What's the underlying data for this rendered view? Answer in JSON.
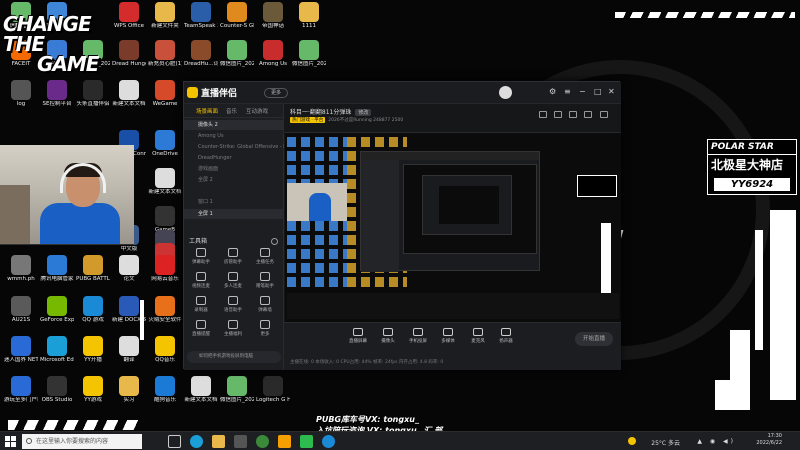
{
  "desktop": {
    "icons": [
      {
        "label": "Brig",
        "color": "#2b5d9c"
      },
      {
        "label": "快捷方式",
        "color": "#3d86d8"
      },
      {
        "label": "WPS Office",
        "color": "#d42c2c"
      },
      {
        "label": "新建文件夹",
        "color": "#e8b94a"
      },
      {
        "label": "TeamSpeak 3",
        "color": "#2a5ea8"
      },
      {
        "label": "Counter-S Global Off...",
        "color": "#e08a1e"
      },
      {
        "label": "帝国神话",
        "color": "#6a5a3a"
      },
      {
        "label": "1111",
        "color": "#e8b94a"
      },
      {
        "label": "FACEIT",
        "color": "#f56a00"
      },
      {
        "label": "平台",
        "color": "#3a7bd5"
      },
      {
        "label": "微信图片_2021080...",
        "color": "#67b96a"
      },
      {
        "label": "Dread Hunger",
        "color": "#7a3b2b"
      },
      {
        "label": "新充员心脏(1)",
        "color": "#c9503a"
      },
      {
        "label": "DreadHu...词罐的下",
        "color": "#8a4b2a"
      },
      {
        "label": "微信图片_2022051...",
        "color": "#67b96a"
      },
      {
        "label": "Among Us",
        "color": "#c92c2c"
      },
      {
        "label": "微信图片_2022062...",
        "color": "#67b96a"
      },
      {
        "label": "log",
        "color": "#555"
      },
      {
        "label": "SE控制平台",
        "color": "#6a2a8a"
      },
      {
        "label": "头条直播伴侣",
        "color": "#2a2a2a"
      },
      {
        "label": "新建文本文档",
        "color": "#ddd"
      },
      {
        "label": "WeGame",
        "color": "#d64a2a"
      },
      {
        "label": "Ubisoft Connect",
        "color": "#1a4fa8"
      },
      {
        "label": "OneDrive",
        "color": "#2d7ad6"
      },
      {
        "label": "腾讯会议",
        "color": "#2a6ad6"
      },
      {
        "label": "新建文本文档",
        "color": "#ddd"
      },
      {
        "label": "Rem",
        "color": "#3a3a3a"
      },
      {
        "label": "GameB",
        "color": "#333"
      },
      {
        "label": "TREL",
        "color": "#445"
      },
      {
        "label": "中文版",
        "color": "#3a5a8a"
      },
      {
        "label": "Feig",
        "color": "#c33"
      },
      {
        "label": "wmmh.ph",
        "color": "#777"
      },
      {
        "label": "腾讯电脑管家",
        "color": "#2a7ad6"
      },
      {
        "label": "PUBG BATTLEGR...",
        "color": "#d29a2a"
      },
      {
        "label": "论文",
        "color": "#ddd"
      },
      {
        "label": "网易云音乐",
        "color": "#d22"
      },
      {
        "label": "腾讯网",
        "color": "#2a7ad6"
      },
      {
        "label": "AU21S",
        "color": "#5a5a5a"
      },
      {
        "label": "GeForce Experience",
        "color": "#76b900"
      },
      {
        "label": "QQ 游戏",
        "color": "#1a8ad6"
      },
      {
        "label": "新建 DOCX 文档",
        "color": "#2a5ab8"
      },
      {
        "label": "火绒安全软件",
        "color": "#e8701a"
      },
      {
        "label": "SYNC 开机启动",
        "color": "#333"
      },
      {
        "label": "迷人国界 NETSHOW...",
        "color": "#2a6ad6"
      },
      {
        "label": "Microsoft Edge",
        "color": "#1aa0d6"
      },
      {
        "label": "YY开播",
        "color": "#f5c400"
      },
      {
        "label": "翻译",
        "color": "#ddd"
      },
      {
        "label": "QQ音乐",
        "color": "#f5c400"
      },
      {
        "label": "新建图片 -20(... 元...",
        "color": "#67b96a"
      },
      {
        "label": "游玩至多门户教程",
        "color": "#2a6ad6"
      },
      {
        "label": "OBS Studio",
        "color": "#333"
      },
      {
        "label": "YY游戏",
        "color": "#f5c400"
      },
      {
        "label": "实习",
        "color": "#e8b94a"
      },
      {
        "label": "酷狗音乐",
        "color": "#1a7ad6"
      },
      {
        "label": "新建文本文档",
        "color": "#ddd"
      },
      {
        "label": "微信图片_2022052...",
        "color": "#67b96a"
      },
      {
        "label": "Logitech G HUB",
        "color": "#2a2a2a"
      },
      {
        "label": "微信图片_2022061...",
        "color": "#67b96a"
      }
    ]
  },
  "logo": {
    "line1": "CHANGE",
    "line2": "THE",
    "line3": "GAME"
  },
  "polar_star": {
    "title": "POLAR STAR",
    "name": "北极星大神店",
    "code": "YY6924"
  },
  "app": {
    "title": "直播伴侣",
    "shortcut": "更多",
    "tabs": [
      "场景画面",
      "音乐",
      "互动游戏"
    ],
    "sources": [
      {
        "label": "摄像头 2",
        "selected": true
      },
      {
        "label": "Among Us",
        "selected": false
      },
      {
        "label": "Counter-Strike: Global Offensive - Direct3D 9",
        "selected": false
      },
      {
        "label": "DreadHunger",
        "selected": false
      },
      {
        "label": "游戏画面",
        "selected": false
      },
      {
        "label": "全屏 2",
        "selected": false
      },
      {
        "label": "窗口 1",
        "selected": false
      },
      {
        "label": "全屏 1",
        "selected": true
      }
    ],
    "tools_header": "工具箱",
    "tools": [
      {
        "label": "弹幕助手"
      },
      {
        "label": "房管助手"
      },
      {
        "label": "主播任务"
      },
      {
        "label": "视频连麦"
      },
      {
        "label": "多人连麦"
      },
      {
        "label": "赠笔助手"
      },
      {
        "label": "录制器"
      },
      {
        "label": "语音助手"
      },
      {
        "label": "弹幕墙"
      },
      {
        "label": "直播提醒"
      },
      {
        "label": "主播福利"
      },
      {
        "label": "更多"
      }
    ],
    "side_hint": "如何把手机游戏投屏到电脑",
    "room_title": "科目一·翻翻811分弹珠",
    "room_edit": "修改",
    "room_meta_tag": "热门游戏 · 平台",
    "room_meta": "2026不过是Running  248877  2500",
    "bottom_buttons": [
      {
        "label": "直播屏幕"
      },
      {
        "label": "摄像头"
      },
      {
        "label": "手机投屏"
      },
      {
        "label": "多媒体"
      },
      {
        "label": "麦克风"
      },
      {
        "label": "扬声器"
      }
    ],
    "start_label": "开始直播",
    "stats": "主播在线: 0  本场收入: 0  CPU占用: 44%  帧率: 24fps  内存占用: 4.8  码率: 0"
  },
  "credits": {
    "line1": "PUBG库车号VX: tongxu_",
    "line2": "入坑陪玩咨询 VX: tongxu_  汇 部"
  },
  "taskbar": {
    "search_placeholder": "在这里输入你要搜索的内容",
    "weather": "25°C 多云",
    "time": "17:30",
    "date": "2022/6/22"
  }
}
